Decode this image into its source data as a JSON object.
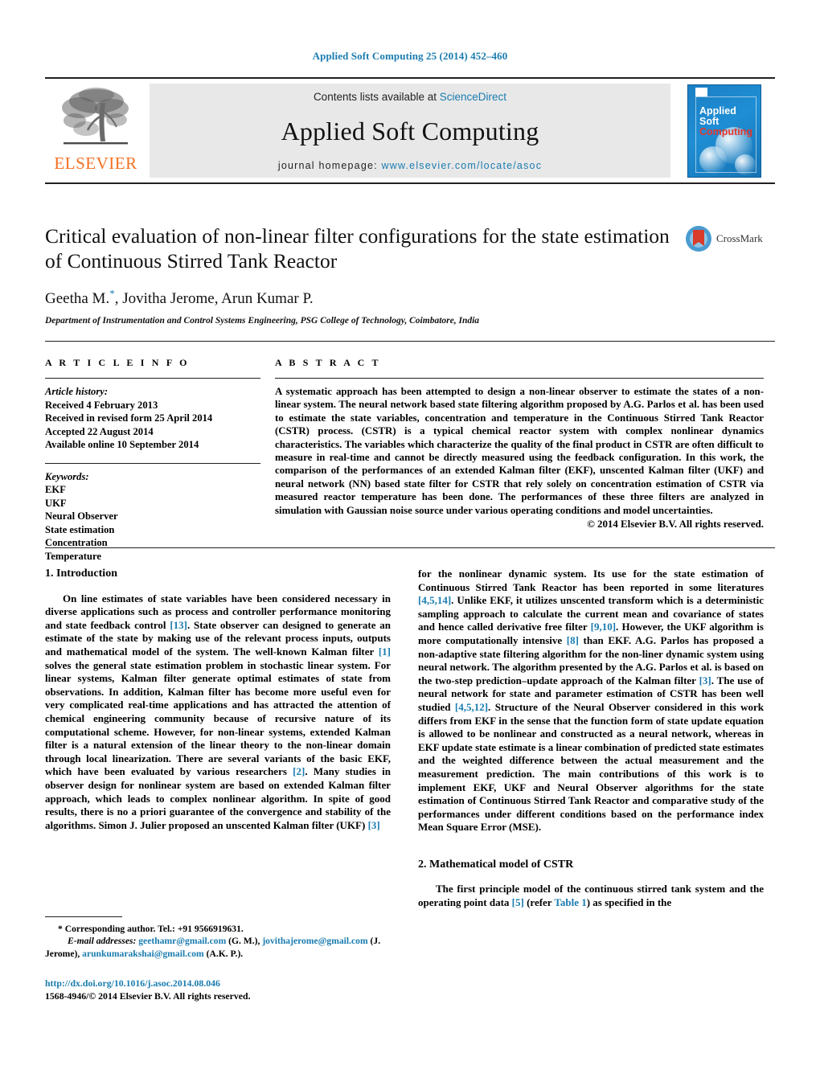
{
  "running_head": "Applied Soft Computing 25 (2014) 452–460",
  "masthead": {
    "publisher_logo_text": "ELSEVIER",
    "contents_prefix": "Contents lists available at ",
    "contents_link": "ScienceDirect",
    "journal_title": "Applied Soft Computing",
    "homepage_prefix": "journal homepage:",
    "homepage_url": "www.elsevier.com/locate/asoc",
    "cover": {
      "line1": "Applied",
      "line2": "Soft",
      "line3": "Computing"
    }
  },
  "article": {
    "title": "Critical evaluation of non-linear filter configurations for the state estimation of Continuous Stirred Tank Reactor",
    "authors": "Geetha M., Jovitha Jerome, Arun Kumar P.",
    "corresponding_marker": "*",
    "affiliation": "Department of Instrumentation and Control Systems Engineering, PSG College of Technology, Coimbatore, India",
    "crossmark_label": "CrossMark"
  },
  "article_info": {
    "heading": "A R T I C L E    I N F O",
    "history_label": "Article history:",
    "history": [
      "Received 4 February 2013",
      "Received in revised form 25 April 2014",
      "Accepted 22 August 2014",
      "Available online 10 September 2014"
    ],
    "keywords_label": "Keywords:",
    "keywords": [
      "EKF",
      "UKF",
      "Neural Observer",
      "State estimation",
      "Concentration",
      "Temperature"
    ]
  },
  "abstract": {
    "heading": "A B S T R A C T",
    "body": "A systematic approach has been attempted to design a non-linear observer to estimate the states of a non-linear system. The neural network based state filtering algorithm proposed by A.G. Parlos et al. has been used to estimate the state variables, concentration and temperature in the Continuous Stirred Tank Reactor (CSTR) process. (CSTR) is a typical chemical reactor system with complex nonlinear dynamics characteristics. The variables which characterize the quality of the final product in CSTR are often difficult to measure in real-time and cannot be directly measured using the feedback configuration. In this work, the comparison of the performances of an extended Kalman filter (EKF), unscented Kalman filter (UKF) and neural network (NN) based state filter for CSTR that rely solely on concentration estimation of CSTR via measured reactor temperature has been done. The performances of these three filters are analyzed in simulation with Gaussian noise source under various operating conditions and model uncertainties.",
    "copyright": "© 2014 Elsevier B.V. All rights reserved."
  },
  "sections": {
    "intro_heading": "1.  Introduction",
    "intro_p1_a": "On line estimates of state variables have been considered necessary in diverse applications such as process and controller performance monitoring and state feedback control ",
    "intro_ref_13": "[13]",
    "intro_p1_b": ". State observer can designed to generate an estimate of the state by making use of the relevant process inputs, outputs and mathematical model of the system. The well-known Kalman filter ",
    "intro_ref_1": "[1]",
    "intro_p1_c": " solves the general state estimation problem in stochastic linear system. For linear systems, Kalman filter generate optimal estimates of state from observations. In addition, Kalman filter has become more useful even for very complicated real-time applications and has attracted the attention of chemical engineering community because of recursive nature of its computational scheme. However, for non-linear systems, extended Kalman filter is a natural extension of the linear theory to the non-linear domain through local linearization. There are several variants of the basic EKF, which have been evaluated by various researchers ",
    "intro_ref_2": "[2]",
    "intro_p1_d": ". Many studies in observer design for nonlinear system are based on extended Kalman filter approach, which leads to complex nonlinear algorithm. In spite of good results, there is no a priori guarantee of the convergence and stability of the algorithms. Simon J. Julier proposed an unscented Kalman filter (UKF) ",
    "intro_ref_3a": "[3]",
    "intro_p1_e": " for the nonlinear dynamic system. Its use for the state estimation of Continuous Stirred Tank Reactor has been reported in some literatures ",
    "intro_ref_4514": "[4,5,14]",
    "intro_p1_f": ". Unlike EKF, it utilizes unscented transform which is a deterministic sampling approach to calculate the current mean and covariance of states and hence called derivative free filter ",
    "intro_ref_910": "[9,10]",
    "intro_p1_g": ". However, the UKF algorithm is more computationally intensive ",
    "intro_ref_8": "[8]",
    "intro_p1_h": " than EKF. A.G. Parlos has proposed a non-adaptive state filtering algorithm for the non-liner dynamic system using neural network. The algorithm presented by the A.G. Parlos et al. is based on the two-step prediction–update approach of the Kalman filter ",
    "intro_ref_3b": "[3]",
    "intro_p1_i": ". The use of neural network for state and parameter estimation of CSTR has been well studied ",
    "intro_ref_4512": "[4,5,12]",
    "intro_p1_j": ". Structure of the Neural Observer considered in this work differs from EKF in the sense that the function form of state update equation is allowed to be nonlinear and constructed as a neural network, whereas in EKF update state estimate is a linear combination of predicted state estimates and the weighted difference between the actual measurement and the measurement prediction. The main contributions of this work is to implement EKF, UKF and Neural Observer algorithms for the state estimation of Continuous Stirred Tank Reactor and comparative study of the performances under different conditions based on the performance index Mean Square Error (MSE).",
    "math_heading": "2.  Mathematical model of CSTR",
    "math_p1_a": "The first principle model of the continuous stirred tank system and the operating point data ",
    "math_ref_5": "[5]",
    "math_p1_b": " (refer ",
    "math_table_link": "Table 1",
    "math_p1_c": ") as specified in the"
  },
  "footnote": {
    "star": "*",
    "corresponding": " Corresponding author. Tel.: +91 9566919631.",
    "email_label": "E-mail addresses:",
    "email1": "geethamr@gmail.com",
    "email1_owner": " (G. M.), ",
    "email2": "jovithajerome@gmail.com",
    "email2_owner": "(J. Jerome), ",
    "email3": "arunkumarakshai@gmail.com",
    "email3_owner": " (A.K. P.)."
  },
  "doi_block": {
    "doi": "http://dx.doi.org/10.1016/j.asoc.2014.08.046",
    "issn_line": "1568-4946/© 2014 Elsevier B.V. All rights reserved."
  },
  "colors": {
    "link": "#1a7cb0",
    "elsevier_orange": "#f37021",
    "cover_blue": "#1b7fc4",
    "cover_red": "#e8352b"
  }
}
